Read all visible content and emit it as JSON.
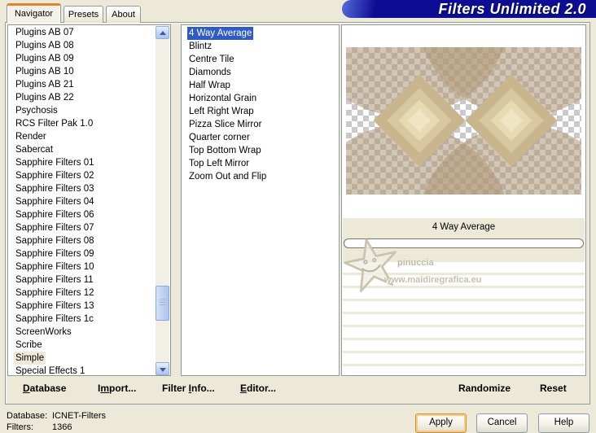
{
  "window": {
    "title": "Filters Unlimited 2.0"
  },
  "tabs": [
    {
      "label": "Navigator",
      "active": true
    },
    {
      "label": "Presets",
      "active": false
    },
    {
      "label": "About",
      "active": false
    }
  ],
  "left_list": {
    "selected": "Simple",
    "items": [
      "Plugins AB 07",
      "Plugins AB 08",
      "Plugins AB 09",
      "Plugins AB 10",
      "Plugins AB 21",
      "Plugins AB 22",
      "Psychosis",
      "RCS Filter Pak 1.0",
      "Render",
      "Sabercat",
      "Sapphire Filters 01",
      "Sapphire Filters 02",
      "Sapphire Filters 03",
      "Sapphire Filters 04",
      "Sapphire Filters 06",
      "Sapphire Filters 07",
      "Sapphire Filters 08",
      "Sapphire Filters 09",
      "Sapphire Filters 10",
      "Sapphire Filters 11",
      "Sapphire Filters 12",
      "Sapphire Filters 13",
      "Sapphire Filters 1c",
      "ScreenWorks",
      "Scribe",
      "Simple",
      "Special Effects 1"
    ]
  },
  "middle_list": {
    "selected": "4 Way Average",
    "items": [
      "4 Way Average",
      "Blintz",
      "Centre Tile",
      "Diamonds",
      "Half Wrap",
      "Horizontal Grain",
      "Left Right Wrap",
      "Pizza Slice Mirror",
      "Quarter corner",
      "Top Bottom Wrap",
      "Top Left Mirror",
      "Zoom Out and Flip"
    ]
  },
  "control_panel": {
    "caption": "4 Way Average"
  },
  "watermark": {
    "line1": "pinuccia",
    "line2": "www.maidiregrafica.eu"
  },
  "command_bar": {
    "database": {
      "pre": "",
      "key": "D",
      "post": "atabase"
    },
    "import": {
      "pre": "I",
      "key": "m",
      "post": "port..."
    },
    "filter_info": {
      "pre": "Filter ",
      "key": "I",
      "post": "nfo..."
    },
    "editor": {
      "pre": "",
      "key": "E",
      "post": "ditor..."
    },
    "randomize": "Randomize",
    "reset": "Reset"
  },
  "status": {
    "database_label": "Database:",
    "database_value": "ICNET-Filters",
    "filters_label": "Filters:",
    "filters_value": "1366"
  },
  "buttons": {
    "apply": "Apply",
    "cancel": "Cancel",
    "help": "Help"
  },
  "colors": {
    "xp_beige": "#ECE9D8",
    "banner_navy": "#0D0D93",
    "banner_swoosh_blue": "#5A6BD8",
    "selection_blue": "#2E5BC6",
    "active_tab_orange": "#E5832C",
    "checker_gray": "#C9C9C9",
    "pattern_tan": "#AE9876"
  }
}
